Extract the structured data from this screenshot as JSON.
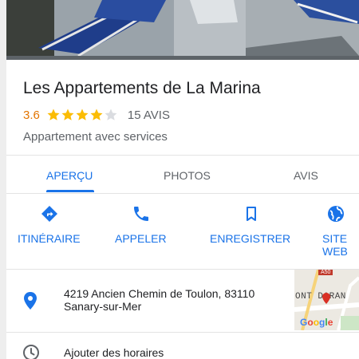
{
  "place": {
    "name": "Les Appartements de La Marina",
    "rating": "3.6",
    "rating_value": 3.6,
    "rating_max": 5,
    "review_count": "15 AVIS",
    "category": "Appartement avec services"
  },
  "tabs": [
    {
      "label": "APERÇU",
      "active": true
    },
    {
      "label": "PHOTOS",
      "active": false
    },
    {
      "label": "AVIS",
      "active": false
    }
  ],
  "actions": [
    {
      "label": "ITINÉRAIRE",
      "icon": "directions-icon"
    },
    {
      "label": "APPELER",
      "icon": "phone-icon"
    },
    {
      "label": "ENREGISTRER",
      "icon": "bookmark-icon"
    },
    {
      "label_line1": "SITE",
      "label_line2": "WEB",
      "icon": "globe-icon"
    }
  ],
  "address": {
    "line1": "4219 Ancien Chemin de Toulon, 83110",
    "line2": "Sanary-sur-Mer",
    "icon": "location-pin-icon",
    "map_road_label": "ONT DARAN",
    "map_badge": "A50",
    "map_watermark": "Google"
  },
  "hours": {
    "label": "Ajouter des horaires",
    "icon": "clock-icon"
  },
  "colors": {
    "accent": "#1a73e8",
    "star": "#fbbc04",
    "rating_text": "#e37400",
    "text_primary": "#202124",
    "text_secondary": "#5f6368"
  }
}
